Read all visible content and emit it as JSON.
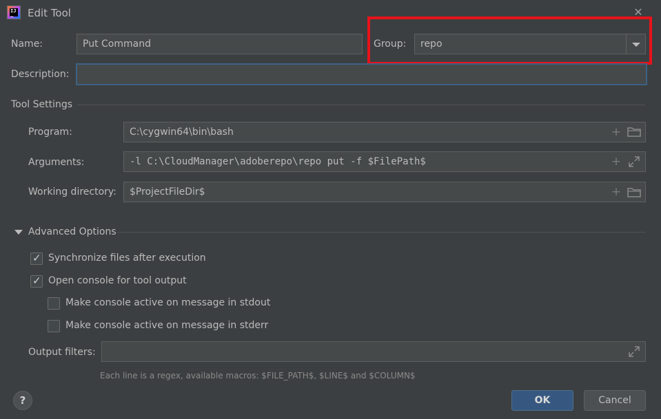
{
  "window": {
    "title": "Edit Tool"
  },
  "form": {
    "name_label": "Name:",
    "name_value": "Put Command",
    "group_label": "Group:",
    "group_value": "repo",
    "description_label": "Description:",
    "description_value": ""
  },
  "tool_settings": {
    "section_label": "Tool Settings",
    "program_label": "Program:",
    "program_value": "C:\\cygwin64\\bin\\bash",
    "arguments_label": "Arguments:",
    "arguments_value": "-l C:\\CloudManager\\adoberepo\\repo put -f $FilePath$",
    "workdir_label": "Working directory:",
    "workdir_value": "$ProjectFileDir$"
  },
  "advanced": {
    "section_label": "Advanced Options",
    "sync_label": "Synchronize files after execution",
    "sync_checked": true,
    "console_label": "Open console for tool output",
    "console_checked": true,
    "stdout_label": "Make console active on message in stdout",
    "stdout_checked": false,
    "stderr_label": "Make console active on message in stderr",
    "stderr_checked": false,
    "output_filters_label": "Output filters:",
    "output_filters_value": "",
    "hint": "Each line is a regex, available macros: $FILE_PATH$, $LINE$ and $COLUMN$"
  },
  "buttons": {
    "ok": "OK",
    "cancel": "Cancel",
    "help": "?"
  },
  "colors": {
    "background": "#3c3f41",
    "field": "#45494a",
    "primary_button": "#365880",
    "highlight": "#e8121a"
  },
  "icons": [
    "app-logo-icon",
    "close-icon",
    "add-icon",
    "folder-icon",
    "expand-icon",
    "chevron-down-icon",
    "checkmark-icon",
    "help-icon"
  ]
}
